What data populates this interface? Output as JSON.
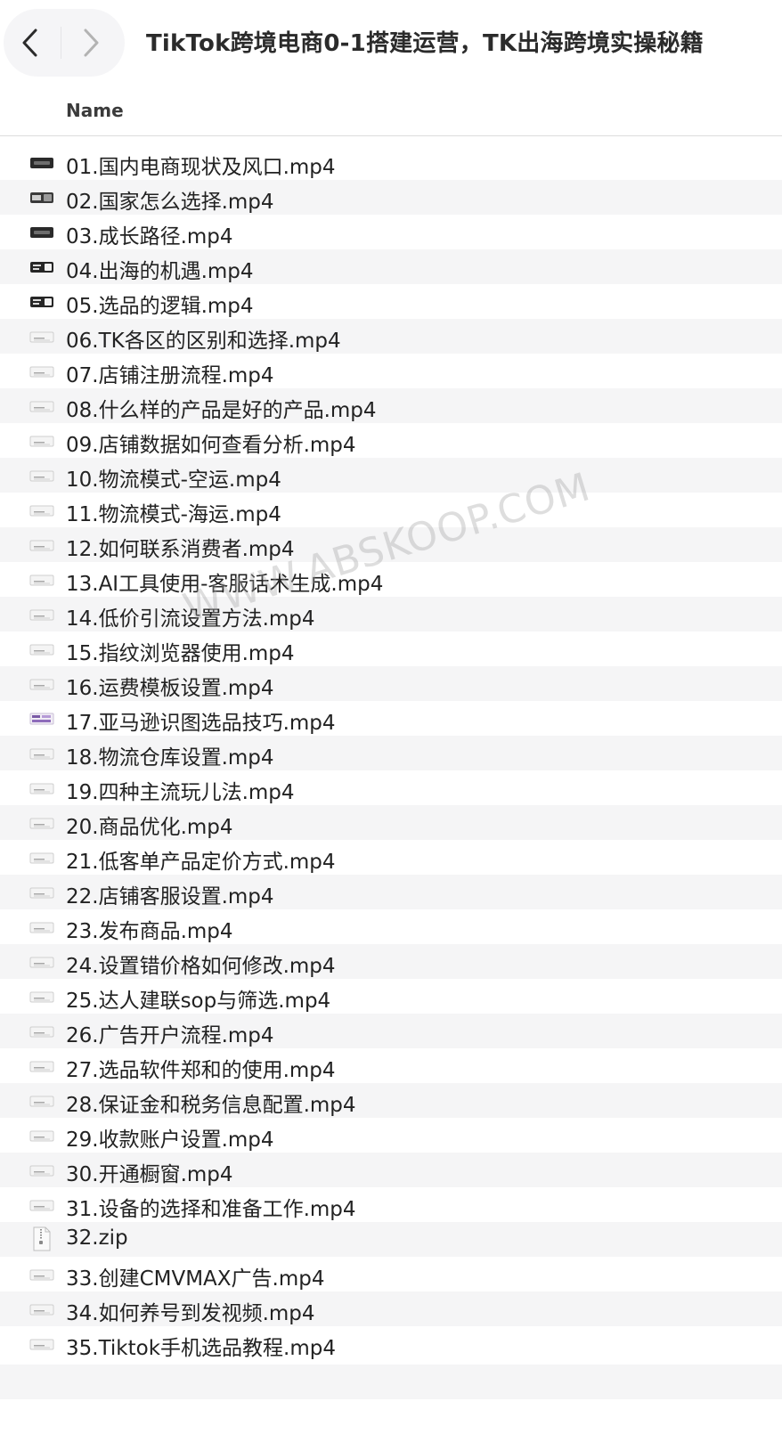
{
  "window": {
    "title": "TikTok跨境电商0-1搭建运营，TK出海跨境实操秘籍"
  },
  "toolbar": {
    "back_icon": "chevron-left-icon",
    "forward_icon": "chevron-right-icon"
  },
  "list_header": {
    "name_label": "Name"
  },
  "files": [
    {
      "name": "01.国内电商现状及风口.mp4",
      "thumb": "dark"
    },
    {
      "name": "02.国家怎么选择.mp4",
      "thumb": "mixed"
    },
    {
      "name": "03.成长路径.mp4",
      "thumb": "dark"
    },
    {
      "name": "04.出海的机遇.mp4",
      "thumb": "dark-split"
    },
    {
      "name": "05.选品的逻辑.mp4",
      "thumb": "dark-split"
    },
    {
      "name": "06.TK各区的区别和选择.mp4",
      "thumb": "light"
    },
    {
      "name": "07.店铺注册流程.mp4",
      "thumb": "light"
    },
    {
      "name": "08.什么样的产品是好的产品.mp4",
      "thumb": "light"
    },
    {
      "name": "09.店铺数据如何查看分析.mp4",
      "thumb": "light"
    },
    {
      "name": "10.物流模式-空运.mp4",
      "thumb": "light"
    },
    {
      "name": "11.物流模式-海运.mp4",
      "thumb": "light"
    },
    {
      "name": "12.如何联系消费者.mp4",
      "thumb": "light"
    },
    {
      "name": "13.AI工具使用-客服话术生成.mp4",
      "thumb": "light"
    },
    {
      "name": "14.低价引流设置方法.mp4",
      "thumb": "light"
    },
    {
      "name": "15.指纹浏览器使用.mp4",
      "thumb": "light"
    },
    {
      "name": "16.运费模板设置.mp4",
      "thumb": "light"
    },
    {
      "name": "17.亚马逊识图选品技巧.mp4",
      "thumb": "purple"
    },
    {
      "name": "18.物流仓库设置.mp4",
      "thumb": "light"
    },
    {
      "name": "19.四种主流玩儿法.mp4",
      "thumb": "light"
    },
    {
      "name": "20.商品优化.mp4",
      "thumb": "light"
    },
    {
      "name": "21.低客单产品定价方式.mp4",
      "thumb": "light"
    },
    {
      "name": "22.店铺客服设置.mp4",
      "thumb": "light"
    },
    {
      "name": "23.发布商品.mp4",
      "thumb": "light"
    },
    {
      "name": "24.设置错价格如何修改.mp4",
      "thumb": "light"
    },
    {
      "name": "25.达人建联sop与筛选.mp4",
      "thumb": "light"
    },
    {
      "name": "26.广告开户流程.mp4",
      "thumb": "light"
    },
    {
      "name": "27.选品软件郑和的使用.mp4",
      "thumb": "light"
    },
    {
      "name": "28.保证金和税务信息配置.mp4",
      "thumb": "light"
    },
    {
      "name": "29.收款账户设置.mp4",
      "thumb": "light"
    },
    {
      "name": "30.开通橱窗.mp4",
      "thumb": "light"
    },
    {
      "name": "31.设备的选择和准备工作.mp4",
      "thumb": "light"
    },
    {
      "name": "32.zip",
      "thumb": "zip"
    },
    {
      "name": "33.创建CMVMAX广告.mp4",
      "thumb": "light"
    },
    {
      "name": "34.如何养号到发视频.mp4",
      "thumb": "light"
    },
    {
      "name": "35.Tiktok手机选品教程.mp4",
      "thumb": "light"
    }
  ],
  "watermark": {
    "text": "WWW.ABSKOOP.COM"
  },
  "colors": {
    "row_alt": "#f5f5f6",
    "text": "#222222",
    "title": "#2b2b2b"
  }
}
